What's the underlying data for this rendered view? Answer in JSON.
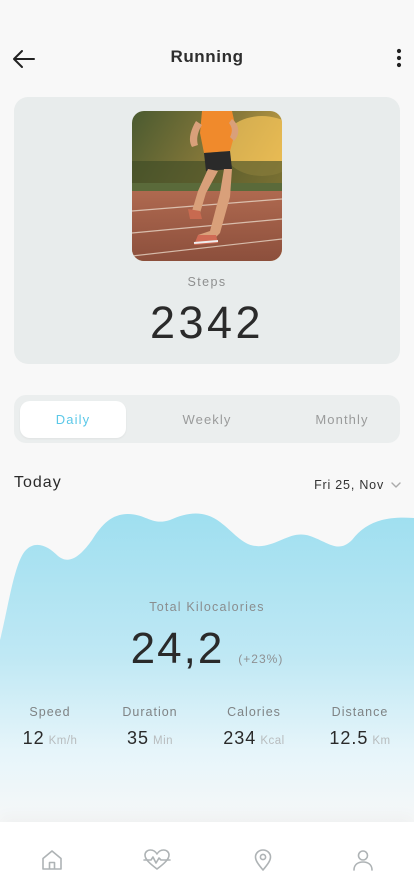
{
  "header": {
    "title": "Running",
    "back_icon": "arrow-left-icon",
    "more_icon": "more-vertical-icon"
  },
  "steps": {
    "label": "Steps",
    "value": "2342"
  },
  "tabs": [
    {
      "label": "Daily",
      "active": true
    },
    {
      "label": "Weekly",
      "active": false
    },
    {
      "label": "Monthly",
      "active": false
    }
  ],
  "today": {
    "label": "Today",
    "date": "Fri 25, Nov"
  },
  "summary": {
    "label": "Total Kilocalories",
    "value": "24,2",
    "change": "(+23%)"
  },
  "stats": [
    {
      "label": "Speed",
      "value": "12",
      "unit": "Km/h"
    },
    {
      "label": "Duration",
      "value": "35",
      "unit": "Min"
    },
    {
      "label": "Calories",
      "value": "234",
      "unit": "Kcal"
    },
    {
      "label": "Distance",
      "value": "12.5",
      "unit": "Km"
    }
  ],
  "nav": [
    {
      "icon": "home-icon",
      "active": false
    },
    {
      "icon": "heart-pulse-icon",
      "active": false
    },
    {
      "icon": "location-pin-icon",
      "active": false
    },
    {
      "icon": "user-icon",
      "active": false
    }
  ],
  "colors": {
    "accent": "#5bc8e8",
    "card_bg": "#e8ecec",
    "wave_top": "#9fdff0",
    "background": "#f8f8f8"
  }
}
